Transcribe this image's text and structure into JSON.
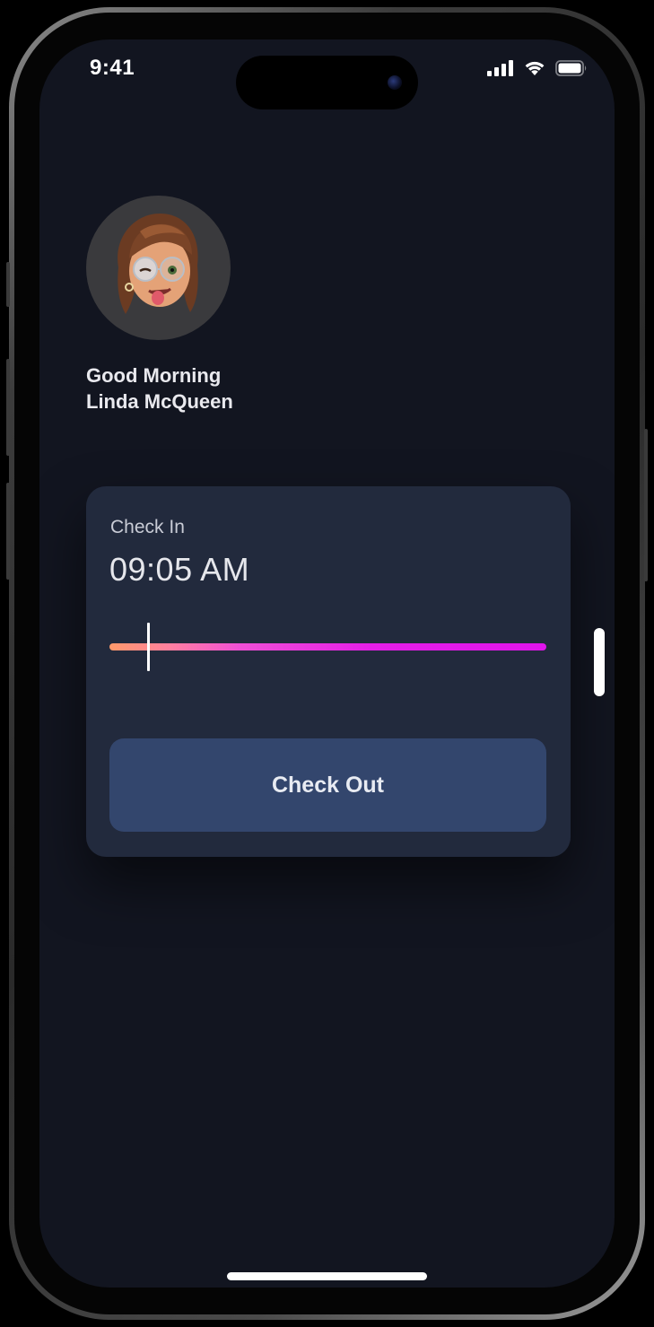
{
  "status_bar": {
    "time": "9:41",
    "icons": [
      "cellular-signal-icon",
      "wifi-icon",
      "battery-icon"
    ]
  },
  "profile": {
    "avatar": "memoji-avatar",
    "greeting_line1": "Good Morning",
    "greeting_line2": "Linda McQueen"
  },
  "attendance_card": {
    "label": "Check In",
    "time": "09:05 AM",
    "progress": 0.09,
    "button_label": "Check Out"
  },
  "colors": {
    "background": "#121520",
    "card": "#222a3d",
    "button": "#33466d",
    "gradient_start": "#ff9a6a",
    "gradient_end": "#e014ec"
  }
}
